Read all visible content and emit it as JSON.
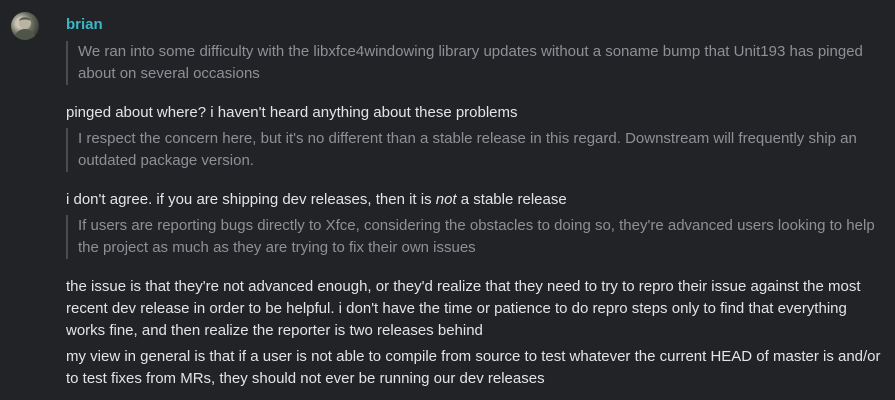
{
  "message": {
    "author": "brian",
    "avatar_icon": "avatar-photo",
    "quote_1": "We ran into some difficulty with the libxfce4windowing library updates without a soname bump that Unit193 has pinged about on several occasions",
    "reply_1": "pinged about where? i haven't heard anything about these problems",
    "quote_2": "I respect the concern here, but it's no different than a stable release in this regard. Downstream will frequently ship an outdated package version.",
    "reply_2_before": "i don't agree. if you are shipping dev releases, then it is ",
    "reply_2_emphasis": "not",
    "reply_2_after": " a stable release",
    "quote_3": "If users are reporting bugs directly to Xfce, considering the obstacles to doing so, they're advanced users looking to help the project as much as they are trying to fix their own issues",
    "reply_3": "the issue is that they're not advanced enough, or they'd realize that they need to try to repro their issue against the most recent dev release in order to be helpful. i don't have the time or patience to do repro steps only to find that everything works fine, and then realize the reporter is two releases behind",
    "reply_4": "my view in general is that if a user is not able to compile from source to test whatever the current HEAD of master is and/or to test fixes from MRs, they should not ever be running our dev releases"
  },
  "colors": {
    "background": "#222326",
    "author": "#3ab7c6",
    "text": "#e3e4e6",
    "quote_text": "#8e9096",
    "quote_border": "#4a4c52"
  }
}
